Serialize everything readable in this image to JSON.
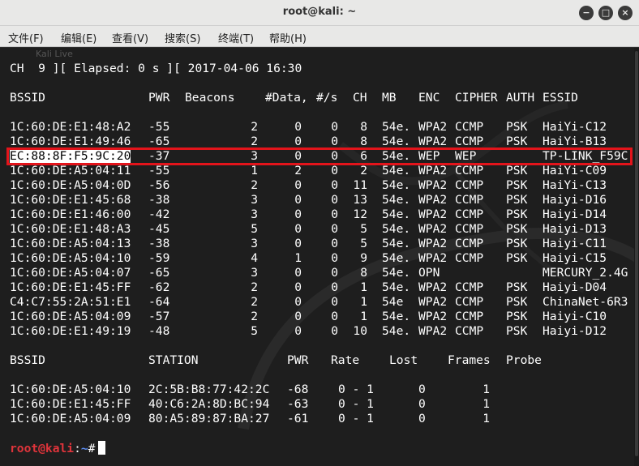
{
  "window": {
    "title": "root@kali: ~",
    "buttons": {
      "minimize": "−",
      "maximize": "□",
      "close": "×"
    }
  },
  "menu": [
    "文件(F)",
    "编辑(E)",
    "查看(V)",
    "搜索(S)",
    "终端(T)",
    "帮助(H)"
  ],
  "watermark": "Kali Live",
  "status_line": "CH  9 ][ Elapsed: 0 s ][ 2017-04-06 16:30",
  "ap_headers": {
    "bssid": "BSSID",
    "pwr": "PWR",
    "beacons": "Beacons",
    "data": "#Data,",
    "rate": "#/s",
    "ch": "CH",
    "mb": "MB",
    "enc": "ENC",
    "cipher": "CIPHER",
    "auth": "AUTH",
    "essid": "ESSID"
  },
  "access_points": [
    {
      "bssid": "1C:60:DE:E1:48:A2",
      "pwr": "-55",
      "beacons": "2",
      "data": "0",
      "rate": "0",
      "ch": "8",
      "mb": "54e.",
      "enc": "WPA2",
      "cipher": "CCMP",
      "auth": "PSK",
      "essid": "HaiYi-C12"
    },
    {
      "bssid": "1C:60:DE:E1:49:46",
      "pwr": "-65",
      "beacons": "2",
      "data": "0",
      "rate": "0",
      "ch": "8",
      "mb": "54e.",
      "enc": "WPA2",
      "cipher": "CCMP",
      "auth": "PSK",
      "essid": "HaiYi-B13"
    },
    {
      "bssid": "EC:88:8F:F5:9C:20",
      "pwr": "-37",
      "beacons": "3",
      "data": "0",
      "rate": "0",
      "ch": "6",
      "mb": "54e.",
      "enc": "WEP",
      "cipher": "WEP",
      "auth": "",
      "essid": "TP-LINK_F59C"
    },
    {
      "bssid": "1C:60:DE:A5:04:11",
      "pwr": "-55",
      "beacons": "1",
      "data": "2",
      "rate": "0",
      "ch": "2",
      "mb": "54e.",
      "enc": "WPA2",
      "cipher": "CCMP",
      "auth": "PSK",
      "essid": "HaiYi-C09"
    },
    {
      "bssid": "1C:60:DE:A5:04:0D",
      "pwr": "-56",
      "beacons": "2",
      "data": "0",
      "rate": "0",
      "ch": "11",
      "mb": "54e.",
      "enc": "WPA2",
      "cipher": "CCMP",
      "auth": "PSK",
      "essid": "HaiYi-C13"
    },
    {
      "bssid": "1C:60:DE:E1:45:68",
      "pwr": "-38",
      "beacons": "3",
      "data": "0",
      "rate": "0",
      "ch": "13",
      "mb": "54e.",
      "enc": "WPA2",
      "cipher": "CCMP",
      "auth": "PSK",
      "essid": "Haiyi-D16"
    },
    {
      "bssid": "1C:60:DE:E1:46:00",
      "pwr": "-42",
      "beacons": "3",
      "data": "0",
      "rate": "0",
      "ch": "12",
      "mb": "54e.",
      "enc": "WPA2",
      "cipher": "CCMP",
      "auth": "PSK",
      "essid": "Haiyi-D14"
    },
    {
      "bssid": "1C:60:DE:E1:48:A3",
      "pwr": "-45",
      "beacons": "5",
      "data": "0",
      "rate": "0",
      "ch": "5",
      "mb": "54e.",
      "enc": "WPA2",
      "cipher": "CCMP",
      "auth": "PSK",
      "essid": "Haiyi-D13"
    },
    {
      "bssid": "1C:60:DE:A5:04:13",
      "pwr": "-38",
      "beacons": "3",
      "data": "0",
      "rate": "0",
      "ch": "5",
      "mb": "54e.",
      "enc": "WPA2",
      "cipher": "CCMP",
      "auth": "PSK",
      "essid": "Haiyi-C11"
    },
    {
      "bssid": "1C:60:DE:A5:04:10",
      "pwr": "-59",
      "beacons": "4",
      "data": "1",
      "rate": "0",
      "ch": "9",
      "mb": "54e.",
      "enc": "WPA2",
      "cipher": "CCMP",
      "auth": "PSK",
      "essid": "Haiyi-C15"
    },
    {
      "bssid": "1C:60:DE:A5:04:07",
      "pwr": "-65",
      "beacons": "3",
      "data": "0",
      "rate": "0",
      "ch": "8",
      "mb": "54e.",
      "enc": "OPN",
      "cipher": "",
      "auth": "",
      "essid": "MERCURY_2.4G"
    },
    {
      "bssid": "1C:60:DE:E1:45:FF",
      "pwr": "-62",
      "beacons": "2",
      "data": "0",
      "rate": "0",
      "ch": "1",
      "mb": "54e.",
      "enc": "WPA2",
      "cipher": "CCMP",
      "auth": "PSK",
      "essid": "Haiyi-D04"
    },
    {
      "bssid": "C4:C7:55:2A:51:E1",
      "pwr": "-64",
      "beacons": "2",
      "data": "0",
      "rate": "0",
      "ch": "1",
      "mb": "54e",
      "enc": "WPA2",
      "cipher": "CCMP",
      "auth": "PSK",
      "essid": "ChinaNet-6R3"
    },
    {
      "bssid": "1C:60:DE:A5:04:09",
      "pwr": "-57",
      "beacons": "2",
      "data": "0",
      "rate": "0",
      "ch": "1",
      "mb": "54e.",
      "enc": "WPA2",
      "cipher": "CCMP",
      "auth": "PSK",
      "essid": "Haiyi-C10"
    },
    {
      "bssid": "1C:60:DE:E1:49:19",
      "pwr": "-48",
      "beacons": "5",
      "data": "0",
      "rate": "0",
      "ch": "10",
      "mb": "54e.",
      "enc": "WPA2",
      "cipher": "CCMP",
      "auth": "PSK",
      "essid": "Haiyi-D12"
    }
  ],
  "station_headers": {
    "bssid": "BSSID",
    "station": "STATION",
    "pwr": "PWR",
    "rate": "Rate",
    "lost": "Lost",
    "frames": "Frames",
    "probe": "Probe"
  },
  "stations": [
    {
      "bssid": "1C:60:DE:A5:04:10",
      "station": "2C:5B:B8:77:42:2C",
      "pwr": "-68",
      "rate": "0 - 1",
      "lost": "0",
      "frames": "1",
      "probe": ""
    },
    {
      "bssid": "1C:60:DE:E1:45:FF",
      "station": "40:C6:2A:8D:BC:94",
      "pwr": "-63",
      "rate": "0 - 1",
      "lost": "0",
      "frames": "1",
      "probe": ""
    },
    {
      "bssid": "1C:60:DE:A5:04:09",
      "station": "80:A5:89:87:BA:27",
      "pwr": "-61",
      "rate": "0 - 1",
      "lost": "0",
      "frames": "1",
      "probe": ""
    }
  ],
  "prompt": {
    "user": "root@kali",
    "sep": ":",
    "path": "~",
    "symbol": "#"
  },
  "colors": {
    "highlight_border": "#e3141b",
    "prompt_user": "#e0343b",
    "prompt_path": "#5c8cf0",
    "terminal_bg": "#1e1e1e"
  }
}
